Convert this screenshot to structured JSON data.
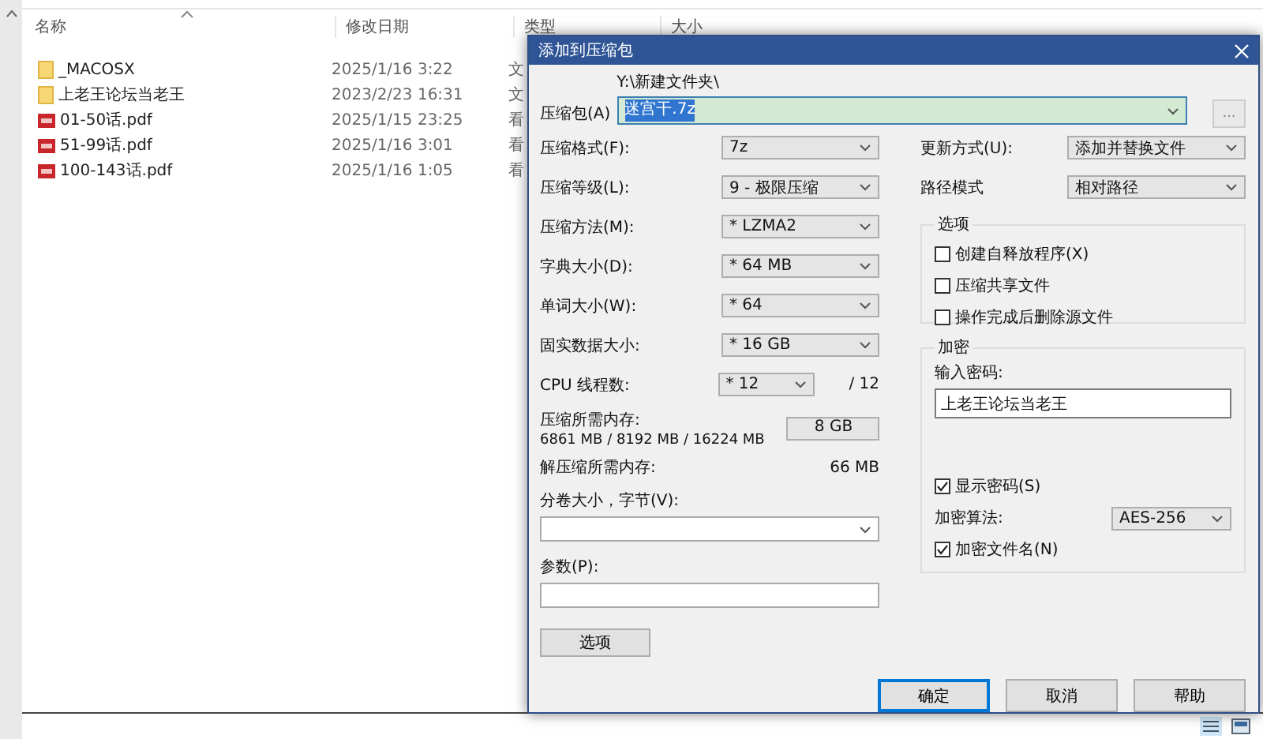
{
  "explorer": {
    "columns": [
      "名称",
      "修改日期",
      "类型",
      "大小"
    ],
    "files": [
      {
        "kind": "folder",
        "name": "_MACOSX",
        "modified": "2025/1/16 3:22",
        "column_3": "文"
      },
      {
        "kind": "folder",
        "name": "上老王论坛当老王",
        "modified": "2023/2/23 16:31",
        "column_3": "文"
      },
      {
        "kind": "pdf",
        "name": "01-50话.pdf",
        "modified": "2025/1/15 23:25",
        "column_3": "看"
      },
      {
        "kind": "pdf",
        "name": "51-99话.pdf",
        "modified": "2025/1/16 3:01",
        "column_3": "看"
      },
      {
        "kind": "pdf",
        "name": "100-143话.pdf",
        "modified": "2025/1/16 1:05",
        "column_3": "看"
      }
    ]
  },
  "dialog": {
    "title": "添加到压缩包",
    "archive": {
      "label": "压缩包(A)",
      "path": "Y:\\新建文件夹\\",
      "value": "迷宫干.7z",
      "text_selected": true,
      "browse": "..."
    },
    "left_fields": [
      {
        "kind": "select",
        "label": "压缩格式(F):",
        "value": "7z"
      },
      {
        "kind": "select",
        "label": "压缩等级(L):",
        "value": "9 - 极限压缩"
      },
      {
        "kind": "select",
        "label": "压缩方法(M):",
        "value": "* LZMA2"
      },
      {
        "kind": "select",
        "label": "字典大小(D):",
        "value": "* 64 MB"
      },
      {
        "kind": "select",
        "label": "单词大小(W):",
        "value": "* 64"
      },
      {
        "kind": "select",
        "label": "固实数据大小:",
        "value": "* 16 GB"
      },
      {
        "kind": "select",
        "label": "CPU 线程数:",
        "value": "* 12",
        "suffix": "/ 12"
      },
      {
        "kind": "memory",
        "label": "压缩所需内存:",
        "detail": "6861 MB / 8192 MB / 16224 MB",
        "value": "8 GB"
      },
      {
        "kind": "info",
        "label": "解压缩所需内存:",
        "value": "66 MB"
      },
      {
        "kind": "combo",
        "label": "分卷大小，字节(V):"
      },
      {
        "kind": "input",
        "label": "参数(P):"
      }
    ],
    "options_button": "选项",
    "right_fields": [
      {
        "label": "更新方式(U):",
        "value": "添加并替换文件"
      },
      {
        "label": "路径模式",
        "value": "相对路径"
      }
    ],
    "options_group": {
      "title": "选项",
      "checkboxes": [
        {
          "label": "创建自释放程序(X)",
          "checked": false
        },
        {
          "label": "压缩共享文件",
          "checked": false
        },
        {
          "label": "操作完成后删除源文件",
          "checked": false
        }
      ]
    },
    "encryption": {
      "title": "加密",
      "password_label": "输入密码:",
      "password": "上老王论坛当老王",
      "show_password": {
        "label": "显示密码(S)",
        "checked": true
      },
      "method_label": "加密算法:",
      "method": "AES-256",
      "encrypt_names": {
        "label": "加密文件名(N)",
        "checked": true
      }
    },
    "buttons": [
      {
        "label": "确定",
        "default": true
      },
      {
        "label": "取消",
        "default": false
      },
      {
        "label": "帮助",
        "default": false
      }
    ]
  }
}
